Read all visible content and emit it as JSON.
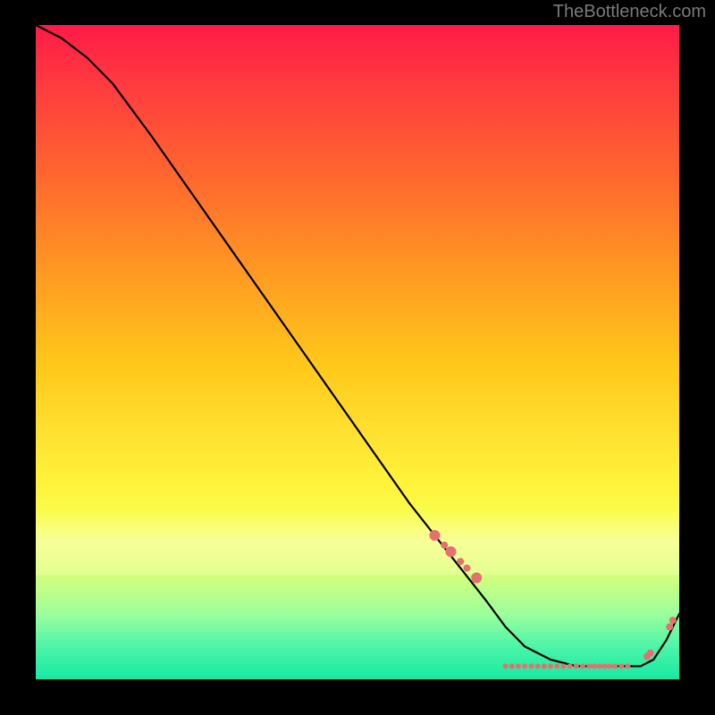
{
  "watermark": "TheBottleneck.com",
  "colors": {
    "marker": "#e6706f",
    "line": "#000000",
    "bg": "#000000"
  },
  "chart_data": {
    "type": "line",
    "title": "",
    "xlabel": "",
    "ylabel": "",
    "xlim": [
      0,
      100
    ],
    "ylim": [
      0,
      100
    ],
    "grid": false,
    "legend": false,
    "series": [
      {
        "name": "curve",
        "kind": "line",
        "x": [
          0,
          4,
          8,
          12,
          18,
          28,
          38,
          48,
          58,
          62,
          66,
          70,
          73,
          76,
          80,
          84,
          88,
          92,
          94,
          96,
          98,
          100
        ],
        "y": [
          100,
          98,
          95,
          91,
          83,
          69,
          55,
          41,
          27,
          22,
          17,
          12,
          8,
          5,
          3,
          2,
          2,
          2,
          2,
          3,
          6,
          10
        ]
      },
      {
        "name": "markers-descending",
        "kind": "scatter",
        "x": [
          62,
          63.5,
          64.5,
          66,
          67,
          68.5
        ],
        "y": [
          22,
          20.5,
          19.5,
          18,
          17,
          15.5
        ],
        "size": [
          6,
          4,
          6,
          4,
          4,
          6
        ]
      },
      {
        "name": "markers-flat",
        "kind": "scatter",
        "x": [
          73,
          74,
          75,
          76,
          77,
          78,
          79,
          80,
          81,
          82,
          83,
          84,
          85,
          86,
          86.8,
          87.6,
          88.4,
          89.2,
          90,
          91,
          92
        ],
        "y": [
          2,
          2,
          2,
          2,
          2,
          2,
          2,
          2,
          2,
          2,
          2,
          2,
          2,
          2,
          2,
          2,
          2,
          2,
          2,
          2,
          2
        ],
        "size": [
          3,
          3,
          3,
          3,
          3,
          3,
          3,
          3,
          3,
          3,
          3,
          3,
          3,
          3,
          3,
          3,
          3,
          3,
          3,
          3,
          3
        ]
      },
      {
        "name": "markers-rising",
        "kind": "scatter",
        "x": [
          95,
          95.5,
          98.5,
          99
        ],
        "y": [
          3.5,
          4,
          8,
          9
        ],
        "size": [
          4,
          4,
          4,
          4
        ]
      }
    ]
  }
}
